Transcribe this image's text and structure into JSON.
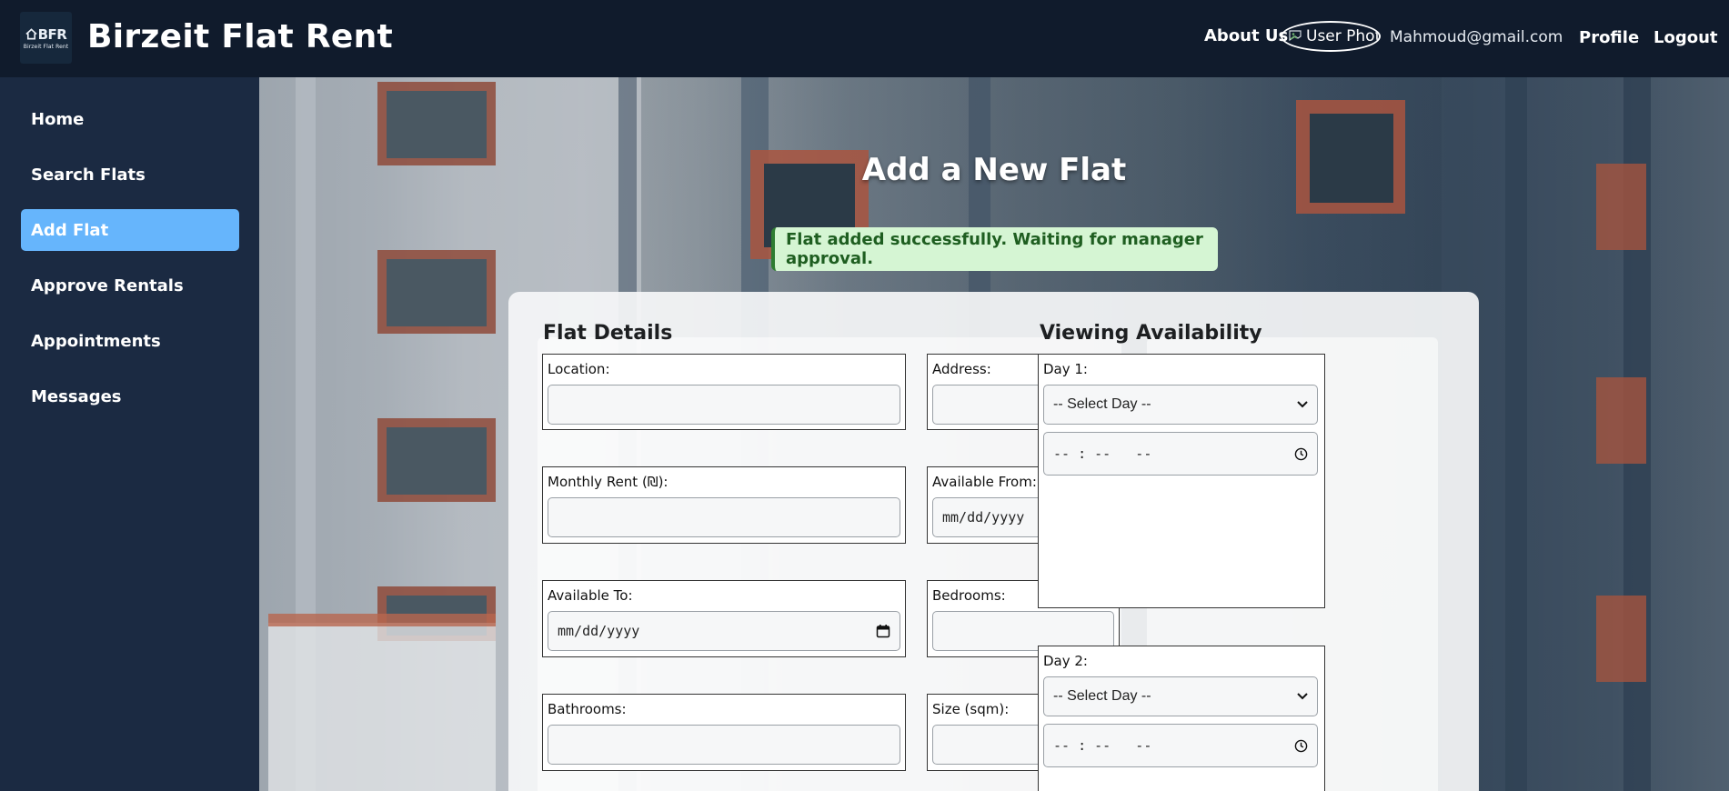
{
  "header": {
    "logo_text": "BFR",
    "logo_sub": "Birzeit Flat Rent",
    "site_title": "Birzeit Flat Rent",
    "about_label": "About Us",
    "user_photo_alt": "User Photo",
    "user_email": "Mahmoud@gmail.com",
    "profile_label": "Profile",
    "logout_label": "Logout"
  },
  "sidebar": {
    "items": [
      {
        "label": "Home"
      },
      {
        "label": "Search Flats"
      },
      {
        "label": "Add Flat",
        "active": true
      },
      {
        "label": "Approve Rentals"
      },
      {
        "label": "Appointments"
      },
      {
        "label": "Messages"
      }
    ]
  },
  "main": {
    "page_title": "Add a New Flat",
    "success_message": "Flat added successfully. Waiting for manager approval."
  },
  "flat_details": {
    "title": "Flat Details",
    "location_label": "Location:",
    "address_label": "Address:",
    "monthly_rent_label": "Monthly Rent (₪):",
    "available_from_label": "Available From:",
    "available_from_value": "mm/dd/yyyy",
    "available_to_label": "Available To:",
    "available_to_value": "mm/dd/yyyy",
    "bedrooms_label": "Bedrooms:",
    "bathrooms_label": "Bathrooms:",
    "size_label": "Size (sqm):"
  },
  "viewing": {
    "title": "Viewing Availability",
    "days": [
      {
        "label": "Day 1:",
        "select_value": "-- Select Day --",
        "time_value": "-- : --   --"
      },
      {
        "label": "Day 2:",
        "select_value": "-- Select Day --",
        "time_value": "-- : --   --"
      }
    ]
  },
  "colors": {
    "header_bg": "#101b2c",
    "sidebar_bg": "#1b2a42",
    "active_nav": "#66b5fc",
    "success_bg": "#d5f5d3",
    "success_text": "#1e5e20"
  }
}
